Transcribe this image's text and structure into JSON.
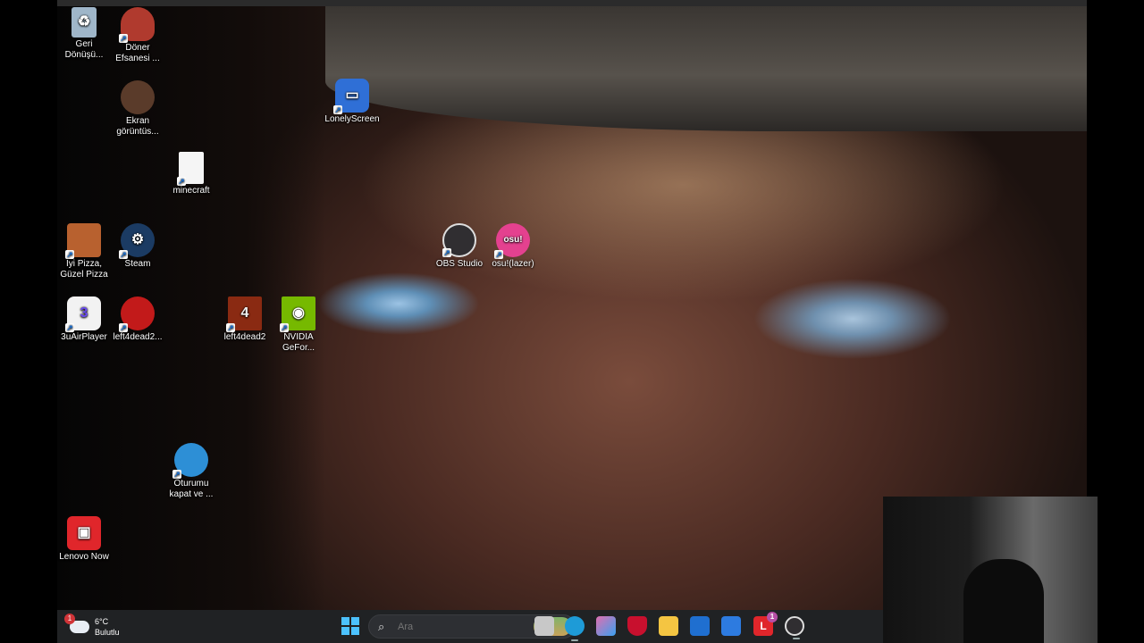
{
  "desktop": {
    "icons": [
      {
        "label": "Geri Dönüşü...",
        "icon": "recycle-bin-icon",
        "color": "#c9d6e3"
      },
      {
        "label": "Döner Efsanesi ...",
        "icon": "doner-game-icon",
        "color": "#b03a2e"
      },
      {
        "label": "Ekran görüntüs...",
        "icon": "screenshot-icon",
        "color": "#5a3b2a"
      },
      {
        "label": "LonelyScreen",
        "icon": "monitor-icon",
        "color": "#2f6fd6"
      },
      {
        "label": "minecraft",
        "icon": "document-icon",
        "color": "#f5f5f5"
      },
      {
        "label": "İyi Pizza, Güzel Pizza",
        "icon": "pizza-icon",
        "color": "#b8612f"
      },
      {
        "label": "Steam",
        "icon": "steam-icon",
        "color": "#1b3b63"
      },
      {
        "label": "OBS Studio",
        "icon": "obs-icon",
        "color": "#302e31"
      },
      {
        "label": "osu!(lazer)",
        "icon": "osu-icon",
        "color": "#e4418f"
      },
      {
        "label": "3uAirPlayer",
        "icon": "airplayer-icon",
        "color": "#6a4bf0"
      },
      {
        "label": "left4dead2...",
        "icon": "shield-shortcut-icon",
        "color": "#c21a1a"
      },
      {
        "label": "left4dead2",
        "icon": "left4dead-icon",
        "color": "#8a2a12"
      },
      {
        "label": "NVIDIA GeFor...",
        "icon": "nvidia-icon",
        "color": "#76b900"
      },
      {
        "label": "Oturumu kapat ve ...",
        "icon": "globe-icon",
        "color": "#2d8fd6"
      },
      {
        "label": "Lenovo Now",
        "icon": "lenovo-now-icon",
        "color": "#e0262b"
      }
    ]
  },
  "taskbar": {
    "weather": {
      "temperature": "6°C",
      "condition": "Bulutlu",
      "badge": "1"
    },
    "search": {
      "placeholder": "Ara"
    },
    "apps": [
      {
        "name": "task-view",
        "icon": "task-view-icon",
        "color": "#c8c8c8"
      },
      {
        "name": "edge",
        "icon": "edge-icon",
        "color": "#1e9bd7"
      },
      {
        "name": "copilot",
        "icon": "copilot-icon",
        "color": "#e06fb0"
      },
      {
        "name": "mcafee",
        "icon": "mcafee-shield-icon",
        "color": "#c8102e"
      },
      {
        "name": "file-explorer",
        "icon": "folder-icon",
        "color": "#f4c542"
      },
      {
        "name": "outlook",
        "icon": "outlook-icon",
        "color": "#1f6fd0"
      },
      {
        "name": "store",
        "icon": "store-icon",
        "color": "#2d7be0"
      },
      {
        "name": "lenovo",
        "icon": "lenovo-icon",
        "color": "#e0262b",
        "badge": "1"
      },
      {
        "name": "obs",
        "icon": "obs-icon",
        "color": "#302e31"
      }
    ]
  }
}
